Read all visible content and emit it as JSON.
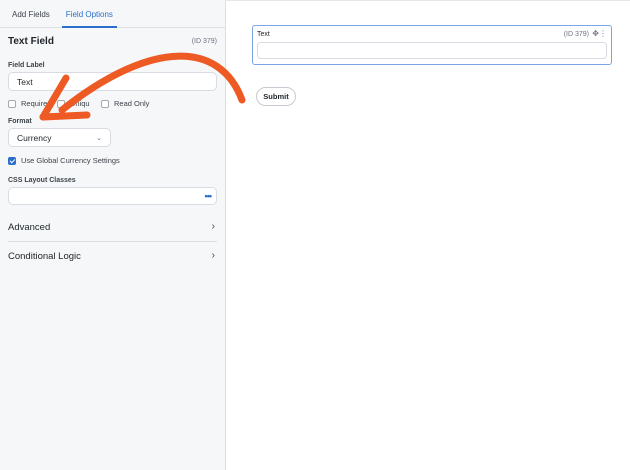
{
  "sidebar": {
    "tabs": [
      {
        "label": "Add Fields",
        "active": false
      },
      {
        "label": "Field Options",
        "active": true
      }
    ],
    "field_type": "Text Field",
    "field_id": "(ID 379)",
    "field_label": {
      "label": "Field Label",
      "value": "Text"
    },
    "checkboxes": {
      "required": {
        "label": "Required",
        "checked": false
      },
      "unique": {
        "label": "Uniqu",
        "checked": false
      },
      "read_only": {
        "label": "Read Only",
        "checked": false
      }
    },
    "format": {
      "label": "Format",
      "selected": "Currency"
    },
    "global_currency": {
      "label": "Use Global Currency Settings",
      "checked": true
    },
    "css_classes": {
      "label": "CSS Layout Classes",
      "value": "",
      "dots_icon": "ellipsis-icon"
    },
    "sections": [
      {
        "label": "Advanced",
        "icon": "chevron-right-icon"
      },
      {
        "label": "Conditional Logic",
        "icon": "chevron-right-icon"
      }
    ]
  },
  "preview": {
    "field_label": "Text",
    "field_id": "(ID 379)",
    "move_icon": "move-icon",
    "menu_icon": "vertical-ellipsis-icon",
    "submit_label": "Submit"
  },
  "colors": {
    "accent": "#2c6ecb",
    "annotation_arrow": "#ee5a24"
  }
}
